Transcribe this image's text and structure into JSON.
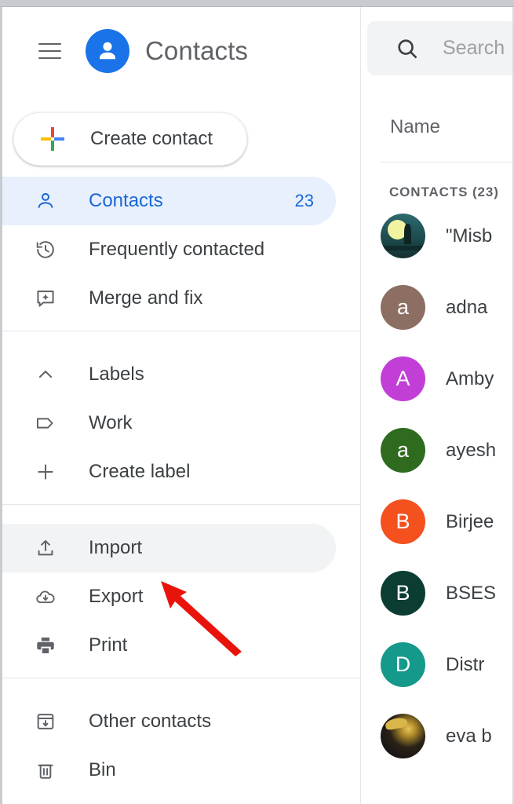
{
  "app": {
    "title": "Contacts",
    "logo_icon": "person-circle-icon",
    "menu_icon": "hamburger-menu-icon"
  },
  "colors": {
    "accent_blue": "#1a73e8",
    "active_pill": "#e8f0fe",
    "active_text": "#1967d2",
    "hover_pill": "#f1f3f4",
    "text_primary": "#3c4043",
    "text_secondary": "#5f6368",
    "annotation_red": "#e8140c",
    "divider": "#e4e6e8"
  },
  "sidebar": {
    "create_button": {
      "label": "Create contact",
      "icon": "google-plus-icon"
    },
    "groups": [
      {
        "items": [
          {
            "label": "Contacts",
            "icon": "person-icon",
            "count": "23",
            "state": "active"
          },
          {
            "label": "Frequently contacted",
            "icon": "history-icon",
            "count": "",
            "state": "normal"
          },
          {
            "label": "Merge and fix",
            "icon": "merge-sparkle-icon",
            "count": "",
            "state": "normal"
          }
        ]
      },
      {
        "items": [
          {
            "label": "Labels",
            "icon": "chevron-up-icon",
            "count": "",
            "state": "normal"
          },
          {
            "label": "Work",
            "icon": "tag-icon",
            "count": "",
            "state": "normal"
          },
          {
            "label": "Create label",
            "icon": "plus-icon",
            "count": "",
            "state": "normal"
          }
        ]
      },
      {
        "items": [
          {
            "label": "Import",
            "icon": "upload-icon",
            "count": "",
            "state": "hovered"
          },
          {
            "label": "Export",
            "icon": "cloud-download-icon",
            "count": "",
            "state": "normal"
          },
          {
            "label": "Print",
            "icon": "printer-icon",
            "count": "",
            "state": "normal"
          }
        ]
      },
      {
        "items": [
          {
            "label": "Other contacts",
            "icon": "archive-down-icon",
            "count": "",
            "state": "normal"
          },
          {
            "label": "Bin",
            "icon": "trash-icon",
            "count": "",
            "state": "normal"
          }
        ]
      }
    ]
  },
  "list_panel": {
    "search": {
      "placeholder": "Search",
      "value": "",
      "icon": "search-icon"
    },
    "column_header": "Name",
    "section_label": "CONTACTS (23)",
    "contacts": [
      {
        "name": "\"Misb",
        "avatar_type": "photo-moon",
        "initial": "",
        "color": "#1d4b4e"
      },
      {
        "name": "adna",
        "avatar_type": "initial",
        "initial": "a",
        "color": "#8d6e63"
      },
      {
        "name": "Amby",
        "avatar_type": "initial",
        "initial": "A",
        "color": "#c13fd6"
      },
      {
        "name": "ayesh",
        "avatar_type": "initial",
        "initial": "a",
        "color": "#2e6b1f"
      },
      {
        "name": "Birjee",
        "avatar_type": "initial",
        "initial": "B",
        "color": "#f4511e"
      },
      {
        "name": "BSES",
        "avatar_type": "initial",
        "initial": "B",
        "color": "#0b3d33"
      },
      {
        "name": "Distr",
        "avatar_type": "initial",
        "initial": "D",
        "color": "#15998a"
      },
      {
        "name": "eva b",
        "avatar_type": "photo-gold",
        "initial": "",
        "color": "#2a2218"
      }
    ]
  },
  "annotation": {
    "type": "arrow",
    "points_to": "Import",
    "color": "#e8140c"
  }
}
